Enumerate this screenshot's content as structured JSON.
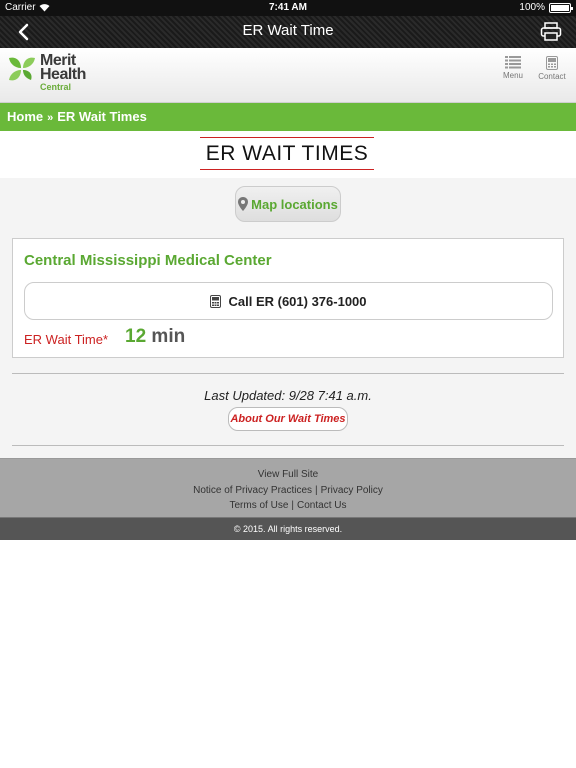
{
  "status_bar": {
    "carrier": "Carrier",
    "time": "7:41 AM",
    "battery": "100%"
  },
  "nav_bar": {
    "title": "ER Wait Time"
  },
  "header": {
    "logo": {
      "line1": "Merit",
      "line2": "Health",
      "line3": "Central"
    },
    "menu_label": "Menu",
    "contact_label": "Contact"
  },
  "breadcrumb": {
    "home": "Home",
    "separator": "»",
    "current": "ER Wait Times"
  },
  "page": {
    "title": "ER WAIT TIMES"
  },
  "map_button": {
    "label": "Map locations"
  },
  "facility": {
    "name": "Central Mississippi Medical Center",
    "call_label": "Call ER (601) 376-1000",
    "wait_label": "ER Wait Time*",
    "wait_number": "12",
    "wait_unit": "min"
  },
  "last_updated": "Last Updated: 9/28 7:41 a.m.",
  "about_button": "About Our Wait Times",
  "footer": {
    "view_full_site": "View Full Site",
    "privacy_practices": "Notice of Privacy Practices",
    "privacy_policy": "Privacy Policy",
    "terms": "Terms of Use",
    "contact_us": "Contact Us",
    "separator": "|",
    "copyright": "© 2015. All rights reserved."
  },
  "colors": {
    "accent_green": "#6ab93a",
    "alert_red": "#cc2222",
    "footer_gray": "#a6a6a6"
  }
}
